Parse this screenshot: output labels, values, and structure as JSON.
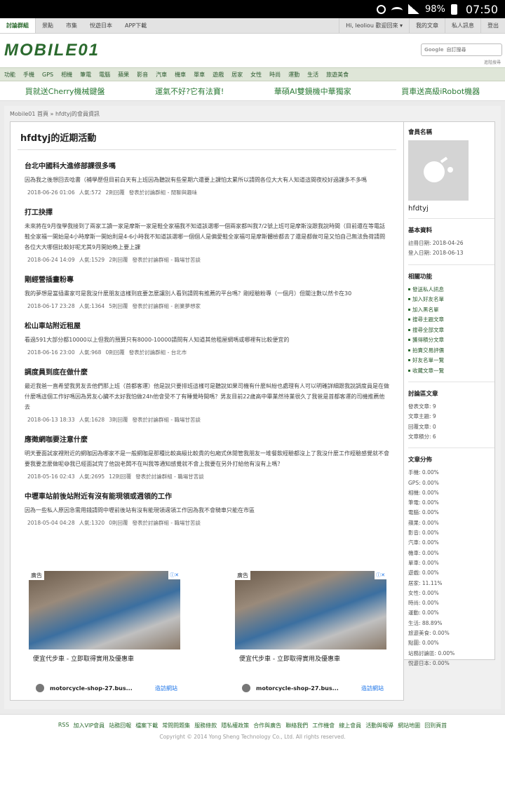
{
  "status": {
    "battery": "98%",
    "time": "07:50"
  },
  "topnav": {
    "tabs": [
      "討論群組",
      "景點",
      "市集",
      "悅遊日本",
      "APP下載"
    ],
    "right": [
      "Hi, leoliou 歡迎回來 ▾",
      "我的文章",
      "私人訊息",
      "登出"
    ]
  },
  "header": {
    "logo": "MOBILE01",
    "search_brand": "Google",
    "search_placeholder": "自訂搜尋",
    "search_link": "進階搜尋"
  },
  "categories": [
    "功能",
    "手機",
    "GPS",
    "相機",
    "筆電",
    "電腦",
    "蘋果",
    "影音",
    "汽車",
    "機車",
    "單車",
    "遊戲",
    "居家",
    "女性",
    "時尚",
    "運動",
    "生活",
    "旅遊美食"
  ],
  "promos": [
    "買就送Cherry機械鍵盤",
    "運氣不好?它有法寶!",
    "華碩AI雙鏡機中華獨家",
    "買車送高級iRobot機器"
  ],
  "breadcrumb": "Mobile01 首頁 » hfdtyj的會員資訊",
  "main": {
    "title": "hfdtyj的近期活動",
    "posts": [
      {
        "title": "台北中國科大進修部課很多嗎",
        "text": "因為我之後想回去唸書（補學歷但目前白天有上班因為聽說有些星期六還要上課怕太累所以請問各位大大有人知道這間夜校好過課多不多嗎",
        "date": "2018-06-26 01:06",
        "views": "人氣:572",
        "replies": "2則回覆",
        "board": "發表於討論群組 - 閒聊與趣味"
      },
      {
        "title": "打工抉擇",
        "text": "未來將在9月復學我接到了兩家工讀一家是摩斯一家是鞋全家福我不知道該選哪一個兩家都叫我7/2號上班可是摩斯沒跟我說時間（目前還在等電話鞋全家福一開始是4小時摩斯一開始則是4-6小時我不知道該選哪一個個人是偏愛鞋全家福可是摩斯體檢都去了還是都做可是又怕自己無法負荷請問各位大大哪個比較好呢尤其9月開始晚上要上課",
        "date": "2018-06-24 14:09",
        "views": "人氣:1529",
        "replies": "2則回覆",
        "board": "發表於討論群組 - 職場甘苦談"
      },
      {
        "title": "剛經營插畫粉專",
        "text": "我的夢想是當插畫家可是我沒什麼朋友這樣到底要怎麼讓別人看到請問有推薦的平台嗎？剛經驗粉專（一個月）但關注數以然卡在30",
        "date": "2018-06-17 23:28",
        "views": "人氣:1364",
        "replies": "5則回覆",
        "board": "發表於討論群組 - 創業夢想家"
      },
      {
        "title": "松山車站附近租屋",
        "text": "看過591大部分都10000以上但我的預算只有8000-10000請問有人知道其他租屋網嗎或哪裡有比較便宜的",
        "date": "2018-06-16 23:00",
        "views": "人氣:968",
        "replies": "0則回覆",
        "board": "發表於討論群組 - 台北市"
      },
      {
        "title": "調度員到底在做什麼",
        "text": "最近我爸一直希望我男友去他們那上班（首都客運）他是說只要排班這樣可是聽說如果司機有什麼糾紛也處理有人可以明確詳細跟我說調度員是在做什麼嗎這個工作好嗎因為男友心臟不太好我怕做24h他會受不了有睡覺時間嗎？男友目前22歲高中畢業然待業很久了我爸是首都客運的司機推薦他去",
        "date": "2018-06-13 18:33",
        "views": "人氣:1628",
        "replies": "3則回覆",
        "board": "發表於討論群組 - 職場甘苦談"
      },
      {
        "title": "應徵網咖要注意什麼",
        "text": "明天要面試家裡附近的網咖因為哪家不是一般網咖是那種比較高級比較貴的包廂式休閒管我朋友一堆餐飲經驗都沒上了我沒什麼工作經驗感覺就不會要我要怎麼做呢😅我已經面試完了他說老闆不在叫我等通知感覺就不會上我要在另外打給他有沒有上嗎？",
        "date": "2018-05-16 02:43",
        "views": "人氣:2695",
        "replies": "12則回覆",
        "board": "發表於討論群組 - 職場甘苦談"
      },
      {
        "title": "中壢車站前後站附近有沒有能現領或週領的工作",
        "text": "因為一些私人原因急需用錢請問中壢前後站有沒有能現領週領工作因為我不會騎車只能在市區",
        "date": "2018-05-04 04:28",
        "views": "人氣:1320",
        "replies": "0則回覆",
        "board": "發表於討論群組 - 職場甘苦談"
      }
    ],
    "ads": [
      {
        "badge": "廣告",
        "caption": "便宜代步車 - 立即取得實用及優惠車",
        "site": "motorcycle-shop-27.bus...",
        "visit": "造訪網站"
      },
      {
        "badge": "廣告",
        "caption": "便宜代步車 - 立即取得實用及優惠車",
        "site": "motorcycle-shop-27.bus...",
        "visit": "造訪網站"
      }
    ]
  },
  "sidebar": {
    "member_title": "會員名稱",
    "username": "hfdtyj",
    "basic_title": "基本資料",
    "basic": [
      "註冊日期: 2018-04-26",
      "登入日期: 2018-06-13"
    ],
    "func_title": "相關功能",
    "funcs": [
      "發送私人訊息",
      "加入好友名單",
      "加入黑名單",
      "搜尋主題文章",
      "搜尋全部文章",
      "獲得積分文章",
      "拍賣交易評價",
      "好友名單一覽",
      "收藏文章一覽"
    ],
    "forum_title": "討論區文章",
    "forum": [
      "發表文章: 9",
      "文章主題: 9",
      "回覆文章: 0",
      "文章積分: 6"
    ],
    "dist_title": "文章分佈",
    "dist": [
      "手機: 0.00%",
      "GPS: 0.00%",
      "相機: 0.00%",
      "筆電: 0.00%",
      "電腦: 0.00%",
      "蘋果: 0.00%",
      "影音: 0.00%",
      "汽車: 0.00%",
      "機車: 0.00%",
      "單車: 0.00%",
      "遊戲: 0.00%",
      "居家: 11.11%",
      "女性: 0.00%",
      "時尚: 0.00%",
      "運動: 0.00%",
      "生活: 88.89%",
      "旅遊美食: 0.00%",
      "點圖: 0.00%",
      "站務討論區: 0.00%",
      "悅遊日本: 0.00%"
    ]
  },
  "footer": {
    "links": [
      "RSS",
      "加入VIP會員",
      "站務回報",
      "檔案下載",
      "常問問題集",
      "服務條款",
      "隱私權政策",
      "合作與廣告",
      "聯絡我們",
      "工作機會",
      "線上會員",
      "活動與報導",
      "網站地圖",
      "回到頁首"
    ],
    "copyright": "Copyright © 2014 Yong Sheng Technology Co., Ltd. All rights reserved."
  }
}
